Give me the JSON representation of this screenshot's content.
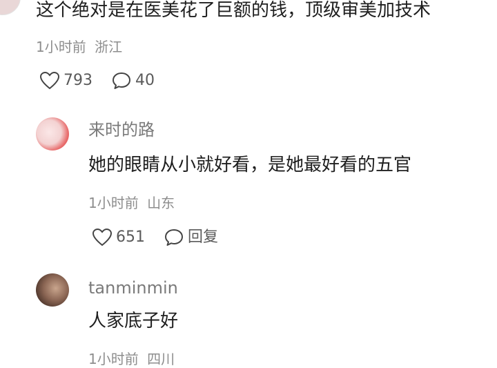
{
  "top_comment": {
    "text": "这个绝对是在医美花了巨额的钱，顶级审美加技术",
    "time": "1小时前",
    "location": "浙江",
    "likes": "793",
    "replies": "40"
  },
  "reply1": {
    "author": "来时的路",
    "text": "她的眼睛从小就好看，是她最好看的五官",
    "time": "1小时前",
    "location": "山东",
    "likes": "651",
    "reply_label": "回复"
  },
  "reply2": {
    "author": "tanminmin",
    "text": "人家底子好",
    "time": "1小时前",
    "location": "四川"
  }
}
